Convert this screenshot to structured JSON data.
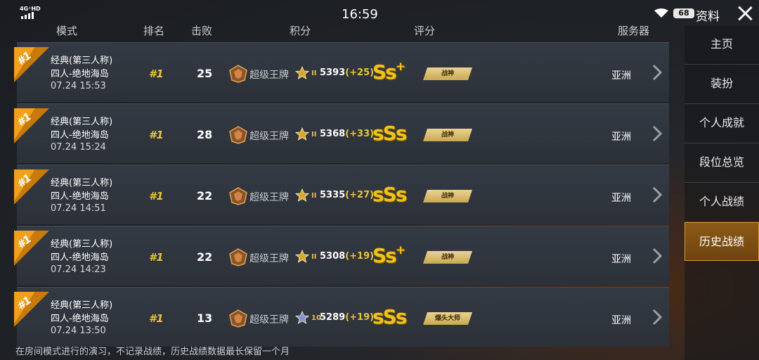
{
  "statusbar": {
    "network": "4G⁺HD",
    "time": "16:59",
    "battery": "68"
  },
  "header": {
    "page_title": "资料",
    "col_mode": "模式",
    "col_rank": "排名",
    "col_kills": "击败",
    "col_points": "积分",
    "col_rating": "评分",
    "col_server": "服务器"
  },
  "matches": [
    {
      "badge": "#1",
      "mode": "经典(第三人称)",
      "map": "四人-绝地海岛",
      "datetime": "07.24 15:53",
      "rank": "#1",
      "kills": "25",
      "tier": "超级王牌",
      "sublevel": "II",
      "score": "5393",
      "delta": "(+25)",
      "grade": "Ss",
      "grade_plus": "+",
      "title": "战神",
      "server": "亚洲",
      "star_color": "#d8a62a"
    },
    {
      "badge": "#1",
      "mode": "经典(第三人称)",
      "map": "四人-绝地海岛",
      "datetime": "07.24 15:24",
      "rank": "#1",
      "kills": "28",
      "tier": "超级王牌",
      "sublevel": "II",
      "score": "5368",
      "delta": "(+33)",
      "grade": "sSs",
      "grade_plus": "",
      "title": "战神",
      "server": "亚洲",
      "star_color": "#d8a62a"
    },
    {
      "badge": "#1",
      "mode": "经典(第三人称)",
      "map": "四人-绝地海岛",
      "datetime": "07.24 14:51",
      "rank": "#1",
      "kills": "22",
      "tier": "超级王牌",
      "sublevel": "II",
      "score": "5335",
      "delta": "(+27)",
      "grade": "sSs",
      "grade_plus": "",
      "title": "战神",
      "server": "亚洲",
      "star_color": "#d8a62a"
    },
    {
      "badge": "#1",
      "mode": "经典(第三人称)",
      "map": "四人-绝地海岛",
      "datetime": "07.24 14:23",
      "rank": "#1",
      "kills": "22",
      "tier": "超级王牌",
      "sublevel": "II",
      "score": "5308",
      "delta": "(+19)",
      "grade": "Ss",
      "grade_plus": "+",
      "title": "战神",
      "server": "亚洲",
      "star_color": "#d8a62a"
    },
    {
      "badge": "#1",
      "mode": "经典(第三人称)",
      "map": "四人-绝地海岛",
      "datetime": "07.24 13:50",
      "rank": "#1",
      "kills": "13",
      "tier": "超级王牌",
      "sublevel": "10",
      "score": "5289",
      "delta": "(+19)",
      "grade": "sSs",
      "grade_plus": "",
      "title": "爆头大师",
      "server": "亚洲",
      "star_color": "#7f93d6"
    }
  ],
  "footnote": "在房间模式进行的演习，不记录战绩，历史战绩数据最长保留一个月",
  "sidebar": {
    "items": [
      {
        "label": "主页",
        "active": false
      },
      {
        "label": "装扮",
        "active": false
      },
      {
        "label": "个人成就",
        "active": false
      },
      {
        "label": "段位总览",
        "active": false
      },
      {
        "label": "个人战绩",
        "active": false
      },
      {
        "label": "历史战绩",
        "active": true
      }
    ]
  },
  "icons": {
    "close": "close-icon",
    "chevron": "chevron-right-icon",
    "tier": "ace-tier-icon",
    "star": "star-icon",
    "wifi": "wifi-icon",
    "signal": "signal-icon"
  },
  "colors": {
    "accent_gold": "#e9c435",
    "active_tab": "#8c5a16",
    "badge_orange": "#f0a01c"
  }
}
